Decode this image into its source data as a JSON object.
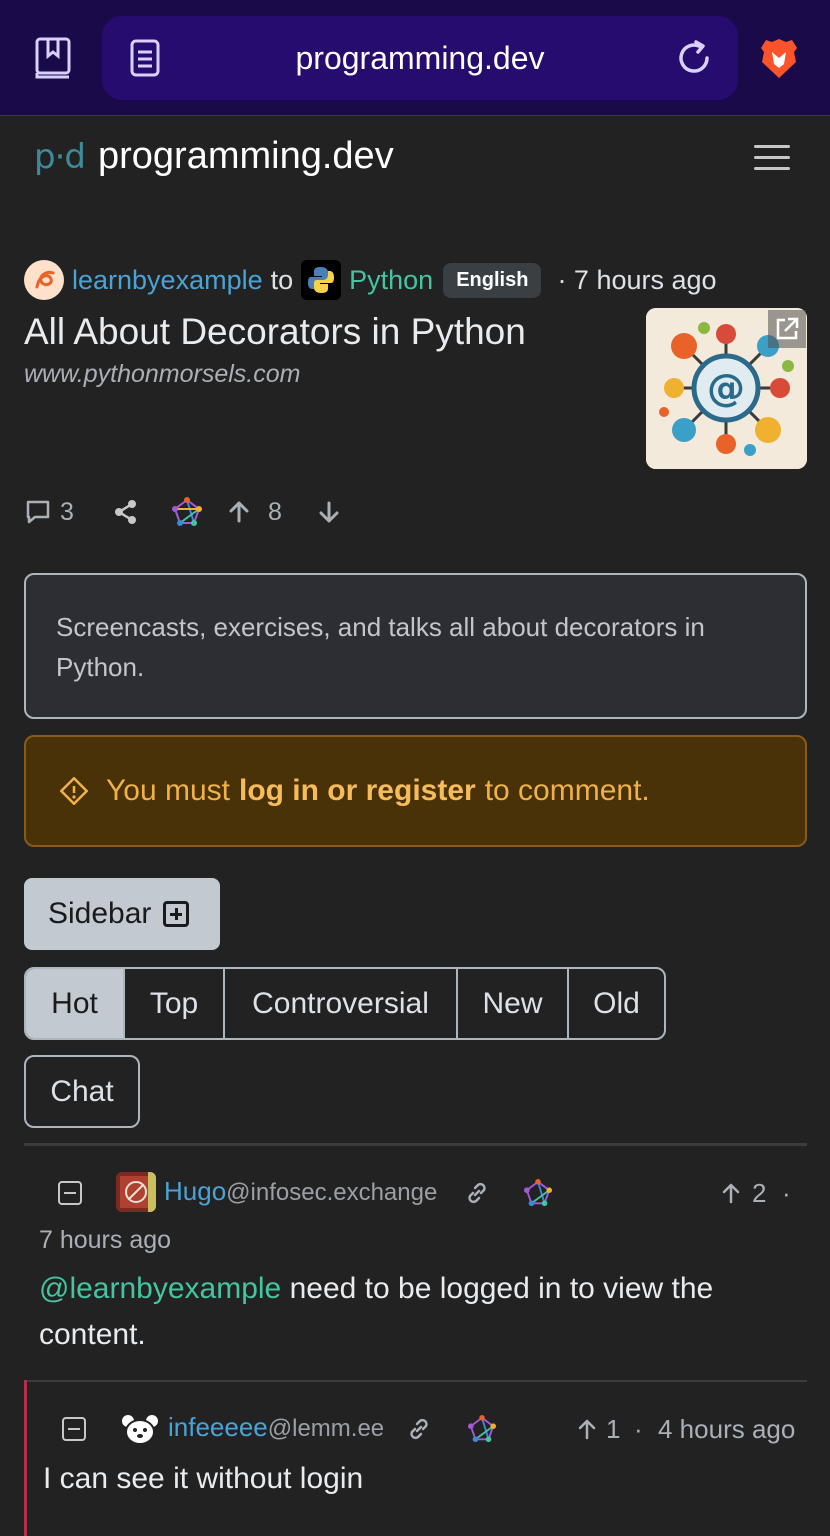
{
  "browser": {
    "url": "programming.dev",
    "icons": [
      "bookmarks-icon",
      "reader-mode-icon",
      "reload-icon",
      "brave-lion-icon"
    ]
  },
  "site": {
    "logo": "p·d",
    "name": "programming.dev"
  },
  "post": {
    "author": "learnbyexample",
    "to": "to",
    "community": "Python",
    "language": "English",
    "time": "· 7 hours ago",
    "title": "All About Decorators in Python",
    "domain": "www.pythonmorsels.com",
    "comments": "3",
    "score": "8",
    "body": "Screencasts, exercises, and talks all about decorators in Python."
  },
  "warning": {
    "before": "You must",
    "link": "log in or register",
    "after": "to comment."
  },
  "sidebar_label": "Sidebar",
  "sort": {
    "options": [
      "Hot",
      "Top",
      "Controversial",
      "New",
      "Old"
    ],
    "active": "Hot"
  },
  "chat_label": "Chat",
  "comments": [
    {
      "user": "Hugo",
      "instance": "@infosec.exchange",
      "score": "2",
      "dot": "·",
      "time": "7 hours ago",
      "mention": "@learnbyexample",
      "text": " need to be logged in to view the content."
    },
    {
      "user": "infeeeee",
      "instance": "@lemm.ee",
      "score": "1",
      "dot": "·",
      "time": "4 hours ago",
      "text": "I can see it without login"
    }
  ],
  "colors": {
    "background": "#222222",
    "link_blue": "#4aa3d6",
    "community_green": "#44c4a1",
    "warning_text": "#f0b04a",
    "browser_bar": "#1a0a4a"
  }
}
